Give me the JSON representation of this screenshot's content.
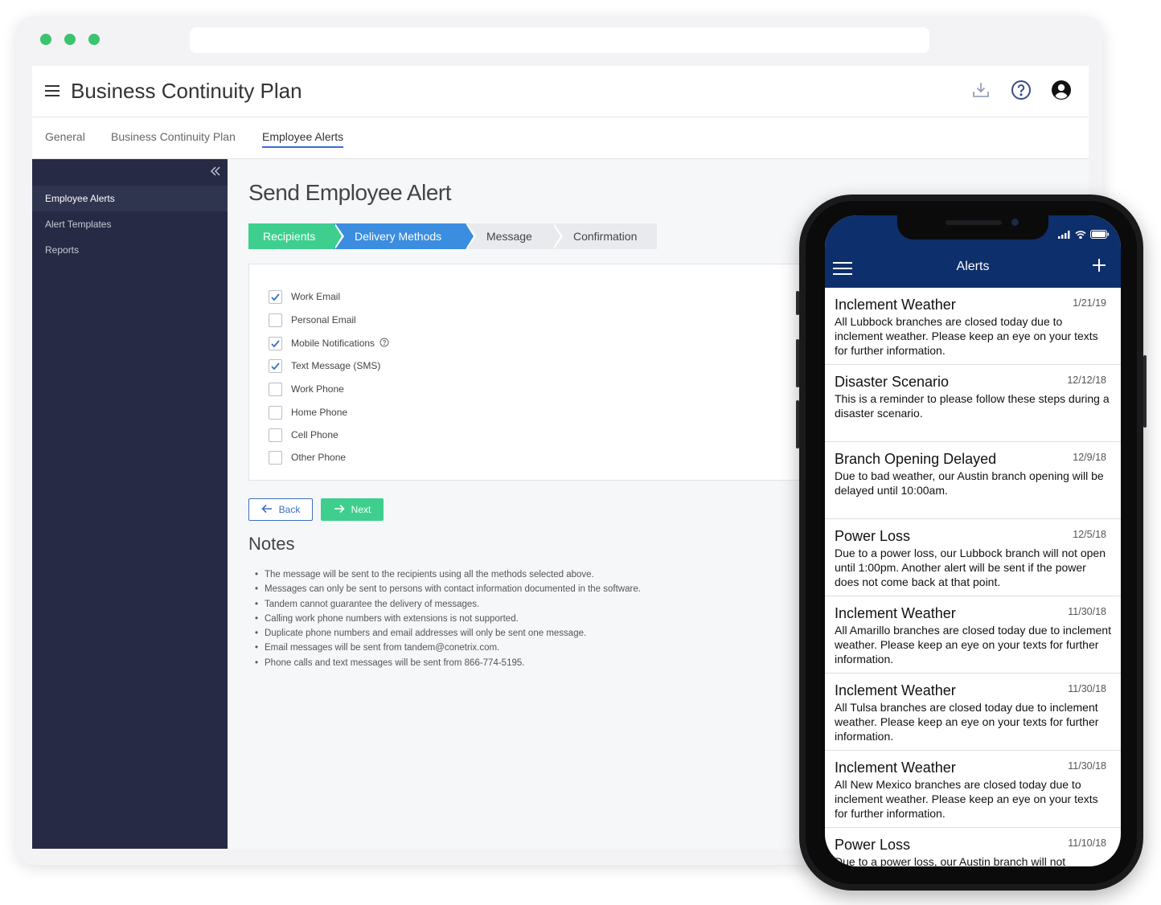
{
  "app": {
    "title": "Business Continuity Plan"
  },
  "tabs": [
    {
      "label": "General"
    },
    {
      "label": "Business Continuity Plan"
    },
    {
      "label": "Employee Alerts"
    }
  ],
  "sidebar": {
    "items": [
      {
        "label": "Employee Alerts"
      },
      {
        "label": "Alert Templates"
      },
      {
        "label": "Reports"
      }
    ]
  },
  "main": {
    "page_title": "Send Employee Alert",
    "steps": [
      {
        "label": "Recipients",
        "state": "done"
      },
      {
        "label": "Delivery Methods",
        "state": "current"
      },
      {
        "label": "Message",
        "state": "pending"
      },
      {
        "label": "Confirmation",
        "state": "pending"
      }
    ],
    "delivery_methods": [
      {
        "label": "Work Email",
        "checked": true
      },
      {
        "label": "Personal Email",
        "checked": false
      },
      {
        "label": "Mobile Notifications",
        "checked": true,
        "has_info": true
      },
      {
        "label": "Text Message (SMS)",
        "checked": true
      },
      {
        "label": "Work Phone",
        "checked": false
      },
      {
        "label": "Home Phone",
        "checked": false
      },
      {
        "label": "Cell Phone",
        "checked": false
      },
      {
        "label": "Other Phone",
        "checked": false
      }
    ],
    "back_label": "Back",
    "next_label": "Next",
    "notes_title": "Notes",
    "notes": [
      "The message will be sent to the recipients using all the methods selected above.",
      "Messages can only be sent to persons with contact information documented in the software.",
      "Tandem cannot guarantee the delivery of messages.",
      "Calling work phone numbers with extensions is not supported.",
      "Duplicate phone numbers and email addresses will only be sent one message.",
      "Email messages will be sent from tandem@conetrix.com.",
      "Phone calls and text messages will be sent from 866-774-5195."
    ]
  },
  "phone": {
    "nav_title": "Alerts",
    "alerts": [
      {
        "title": "Inclement Weather",
        "date": "1/21/19",
        "body": "All Lubbock branches are closed today due to inclement weather. Please keep an eye on your texts for further information."
      },
      {
        "title": "Disaster Scenario",
        "date": "12/12/18",
        "body": "This is a reminder to please follow these steps during a disaster scenario."
      },
      {
        "title": "Branch Opening Delayed",
        "date": "12/9/18",
        "body": "Due to bad weather, our Austin branch opening will be delayed until 10:00am."
      },
      {
        "title": "Power Loss",
        "date": "12/5/18",
        "body": "Due to a power loss, our Lubbock branch will not open until 1:00pm. Another alert will be sent if the power does not come back at that point."
      },
      {
        "title": "Inclement Weather",
        "date": "11/30/18",
        "body": "All Amarillo branches are closed today due to inclement weather. Please keep an eye on your texts for further information."
      },
      {
        "title": "Inclement Weather",
        "date": "11/30/18",
        "body": "All Tulsa branches are closed today due to inclement weather. Please keep an eye on your texts for further information."
      },
      {
        "title": "Inclement Weather",
        "date": "11/30/18",
        "body": "All New Mexico branches are closed today due to inclement weather. Please keep an eye on your texts for further information."
      },
      {
        "title": "Power Loss",
        "date": "11/10/18",
        "body": "Due to a power loss, our Austin branch will not"
      }
    ]
  },
  "colors": {
    "sidebar_bg": "#262a44",
    "step_done": "#3ecf8e",
    "step_current": "#3b8de0",
    "phone_header": "#0d2f6b",
    "browser_dots": "#3cc36f"
  },
  "icons": {
    "download": "download-icon",
    "help": "help-circle-icon",
    "account": "account-circle-icon",
    "collapse": "double-chevron-left-icon"
  }
}
